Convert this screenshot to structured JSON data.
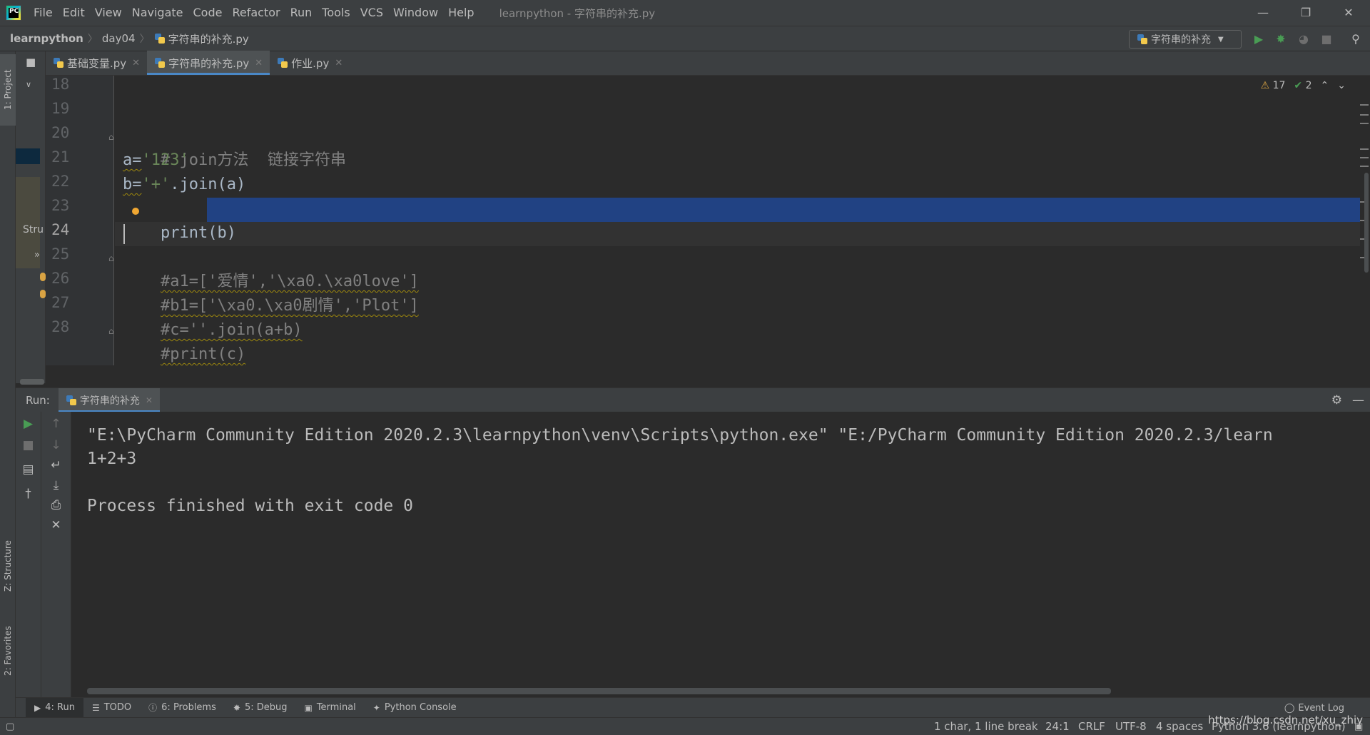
{
  "menubar": {
    "items": [
      "File",
      "Edit",
      "View",
      "Navigate",
      "Code",
      "Refactor",
      "Run",
      "Tools",
      "VCS",
      "Window",
      "Help"
    ],
    "title": "learnpython - 字符串的补充.py"
  },
  "navbar": {
    "crumbs": [
      "learnpython",
      "day04",
      "字符串的补充.py"
    ],
    "run_config": "字符串的补充"
  },
  "left_stripe": {
    "project": "1: Project",
    "structure": "Z: Structure",
    "favorites": "2: Favorites",
    "structure_short": "Stru"
  },
  "editor_tabs": [
    {
      "label": "基础变量.py",
      "active": false
    },
    {
      "label": "字符串的补充.py",
      "active": true
    },
    {
      "label": "作业.py",
      "active": false
    }
  ],
  "inspections": {
    "warnings": "17",
    "weak_warnings": "2"
  },
  "editor": {
    "line_numbers": [
      "18",
      "19",
      "20",
      "21",
      "22",
      "23",
      "24",
      "25",
      "26",
      "27",
      "28"
    ],
    "current_line": "24",
    "lines": {
      "l20": "# join方法  链接字符串",
      "l21_a": "a=",
      "l21_b": "'123'",
      "l22_a": "b=",
      "l22_b": "'+'",
      "l22_c": ".join(a)",
      "l23": "print(b)",
      "l25": "#a1=['爱情','\\xa0.\\xa0love']",
      "l26": "#b1=['\\xa0.\\xa0剧情','Plot']",
      "l27": "#c=''.join(a+b)",
      "l28": "#print(c)"
    }
  },
  "run_panel": {
    "label": "Run:",
    "tab": "字符串的补充",
    "console": [
      "\"E:\\PyCharm Community Edition 2020.2.3\\learnpython\\venv\\Scripts\\python.exe\" \"E:/PyCharm Community Edition 2020.2.3/learn",
      "1+2+3",
      "",
      "Process finished with exit code 0"
    ]
  },
  "bottom_tabs": [
    {
      "label": "4: Run",
      "icon": "run-icon",
      "active": true
    },
    {
      "label": "TODO",
      "icon": "list-icon",
      "active": false
    },
    {
      "label": "6: Problems",
      "icon": "problems-icon",
      "active": false
    },
    {
      "label": "5: Debug",
      "icon": "bug-icon",
      "active": false
    },
    {
      "label": "Terminal",
      "icon": "terminal-icon",
      "active": false
    },
    {
      "label": "Python Console",
      "icon": "python-icon",
      "active": false
    }
  ],
  "event_log": "Event Log",
  "statusbar": {
    "selection": "1 char, 1 line break",
    "position": "24:1",
    "line_sep": "CRLF",
    "encoding": "UTF-8",
    "indent": "4 spaces",
    "interpreter": "Python 3.6 (learnpython)",
    "watermark": "https://blog.csdn.net/xu_zhiy"
  },
  "colors": {
    "background": "#2b2b2b",
    "panel": "#3c3f41",
    "selection": "#214283",
    "accent": "#4a88c7",
    "string": "#6a8759",
    "comment": "#808080",
    "run_green": "#499c54"
  }
}
